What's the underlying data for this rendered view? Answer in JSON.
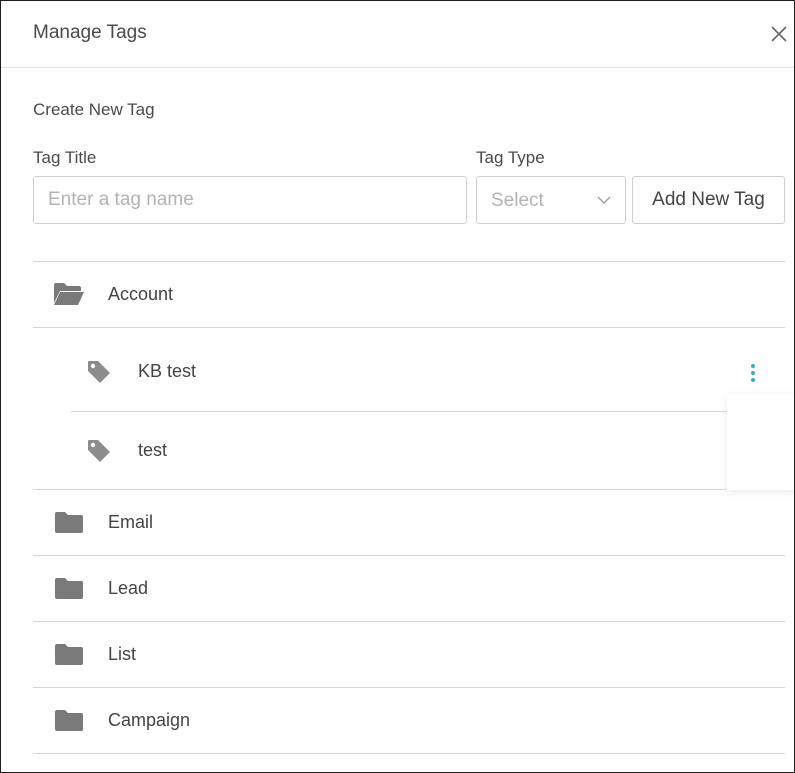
{
  "dialog": {
    "title": "Manage Tags",
    "close_icon": "close-icon"
  },
  "create": {
    "section_title": "Create New Tag",
    "tag_title_label": "Tag Title",
    "tag_title_placeholder": "Enter a tag name",
    "tag_title_value": "",
    "tag_type_label": "Tag Type",
    "tag_type_value": "Select",
    "add_button_label": "Add New Tag"
  },
  "folders": [
    {
      "label": "Account",
      "icon": "folder-open-icon",
      "expanded": true,
      "tags": [
        {
          "label": "KB test",
          "icon": "tag-icon"
        },
        {
          "label": "test",
          "icon": "tag-icon"
        }
      ]
    },
    {
      "label": "Email",
      "icon": "folder-icon"
    },
    {
      "label": "Lead",
      "icon": "folder-icon"
    },
    {
      "label": "List",
      "icon": "folder-icon"
    },
    {
      "label": "Campaign",
      "icon": "folder-icon"
    }
  ],
  "colors": {
    "icon_grey": "#7a7a7a",
    "tag_grey": "#8c8c8c",
    "kebab_accent": "#3fa9bf",
    "divider": "#d7d7d7"
  }
}
